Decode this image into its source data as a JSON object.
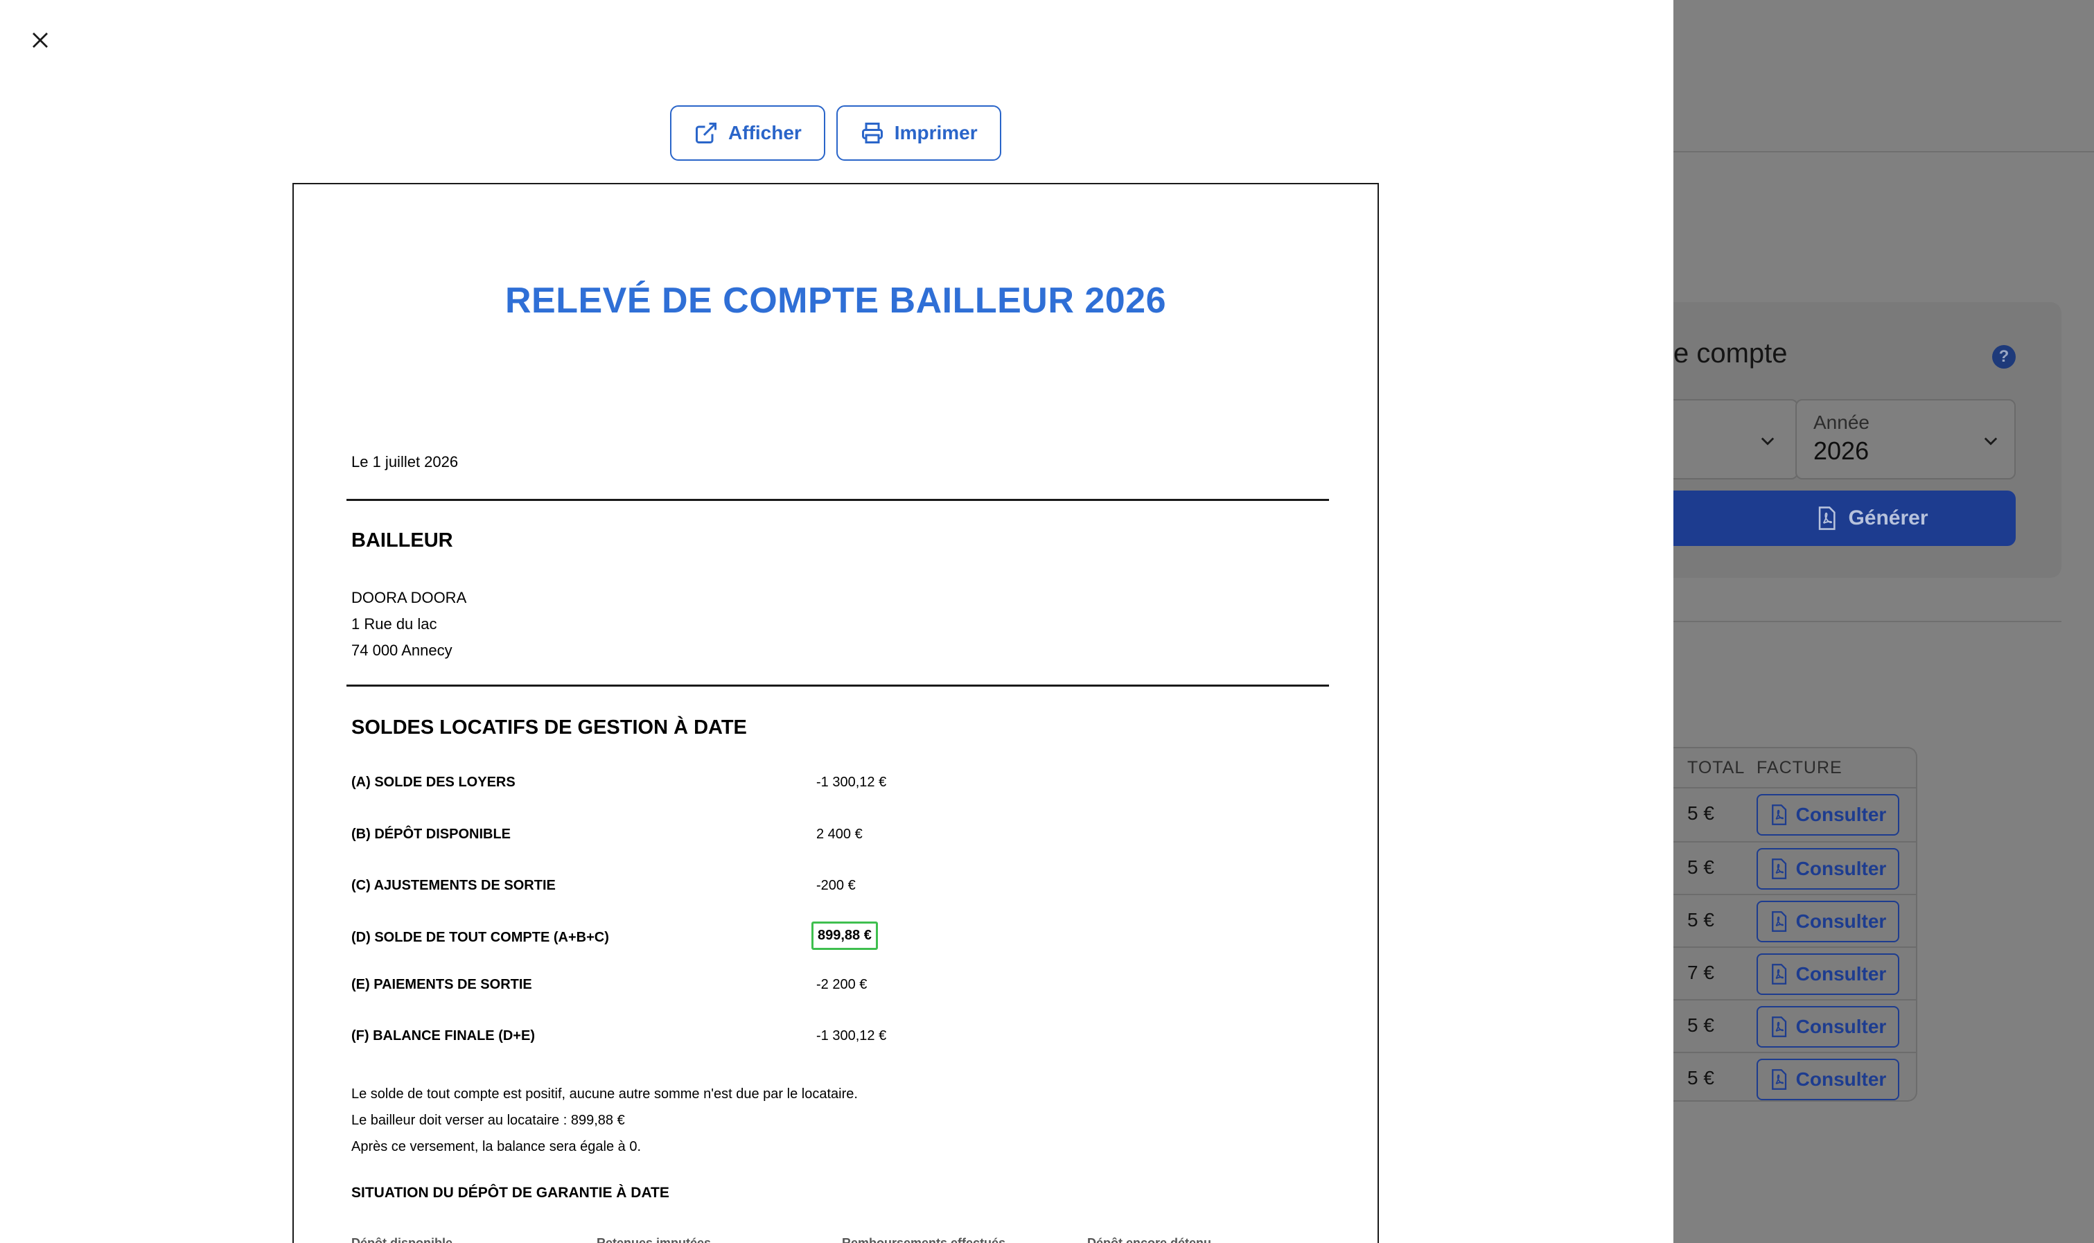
{
  "modal": {
    "close_icon": "close-icon",
    "toolbar": {
      "open_label": "Afficher",
      "print_label": "Imprimer"
    }
  },
  "document": {
    "title": "RELEVÉ DE COMPTE BAILLEUR 2026",
    "date": "Le 1 juillet 2026",
    "bailleur": {
      "heading": "BAILLEUR",
      "name": "DOORA DOORA",
      "street": "1 Rue du lac",
      "city": "74 000 Annecy"
    },
    "soldes": {
      "heading": "SOLDES LOCATIFS DE GESTION À DATE",
      "rows": [
        {
          "label": "(A) SOLDE DES LOYERS",
          "value": "-1 300,12 €"
        },
        {
          "label": "(B) DÉPÔT DISPONIBLE",
          "value": "2 400 €"
        },
        {
          "label": "(C) AJUSTEMENTS DE SORTIE",
          "value": "-200 €"
        },
        {
          "label": "(D) SOLDE DE TOUT COMPTE (A+B+C)",
          "value": "899,88 €"
        },
        {
          "label": "(E) PAIEMENTS DE SORTIE",
          "value": "-2 200 €"
        },
        {
          "label": "(F) BALANCE FINALE (D+E)",
          "value": "-1 300,12 €"
        }
      ]
    },
    "notes": [
      "Le solde de tout compte est positif, aucune autre somme n'est due par le locataire.",
      "Le bailleur doit verser au locataire : 899,88 €",
      "Après ce versement, la balance sera égale à 0."
    ],
    "deposit": {
      "heading": "SITUATION DU DÉPÔT DE GARANTIE À DATE",
      "columns": [
        "Dépôt disponible",
        "Retenues imputées",
        "Remboursements effectués",
        "Dépôt encore détenu"
      ]
    }
  },
  "background": {
    "card_title": "e compte",
    "year_select": {
      "label": "Année",
      "value": "2026"
    },
    "generate_label": "Générer",
    "table": {
      "headers": [
        "TOTAL",
        "FACTURE"
      ],
      "rows": [
        {
          "total": "5 €",
          "action": "Consulter"
        },
        {
          "total": "5 €",
          "action": "Consulter"
        },
        {
          "total": "5 €",
          "action": "Consulter"
        },
        {
          "total": "7 €",
          "action": "Consulter"
        },
        {
          "total": "5 €",
          "action": "Consulter"
        },
        {
          "total": "5 €",
          "action": "Consulter"
        }
      ]
    }
  },
  "colors": {
    "accent": "#2a65c9",
    "title_blue": "#2f6fd6",
    "highlight_green": "#3fbf4f",
    "overlay": "#808080"
  }
}
